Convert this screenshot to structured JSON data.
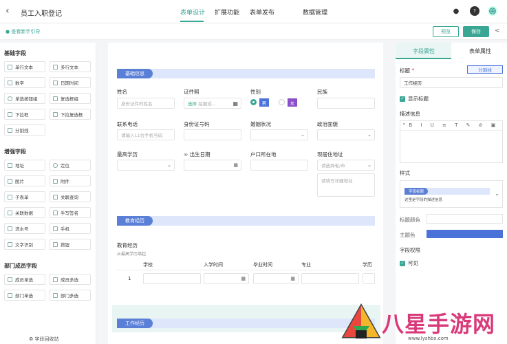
{
  "topbar": {
    "title": "员工入职登记",
    "tabs": [
      "表单设计",
      "扩展功能",
      "表单发布",
      "数据管理"
    ],
    "active_tab": "表单设计",
    "icons": [
      "bell-icon",
      "help-icon",
      "avatar"
    ]
  },
  "subbar": {
    "tip": "查看新手引导",
    "preview_label": "预览",
    "save_label": "保存"
  },
  "left": {
    "basic_group": "基础字段",
    "basic_fields": [
      "单行文本",
      "多行文本",
      "数字",
      "日期时间",
      "单选按钮组",
      "复选框组",
      "下拉框",
      "下拉复选框",
      "分割线"
    ],
    "enhanced_group": "增强字段",
    "enhanced_fields": [
      "地址",
      "定位",
      "图片",
      "附件",
      "子表单",
      "关联查询",
      "关联数据",
      "手写签名",
      "流水号",
      "手机",
      "文字识别",
      "按钮"
    ],
    "dept_group": "部门成员字段",
    "dept_fields": [
      "成员单选",
      "成员多选",
      "部门单选",
      "部门多选"
    ],
    "recycle": "字段回收站"
  },
  "canvas": {
    "section_basic": "基础信息",
    "name_label": "姓名",
    "name_placeholder": "身份证件的姓名",
    "idphoto_label": "证件照",
    "idphoto_select": "选择",
    "idphoto_hint": "拍摄或...",
    "gender_label": "性别",
    "gender_male": "男",
    "gender_female": "女",
    "ethnic_label": "民族",
    "phone_label": "联系电话",
    "phone_placeholder": "请输入11位手机号码",
    "idnum_label": "身份证号码",
    "marital_label": "婚姻状况",
    "political_label": "政治面貌",
    "edu_label": "最高学历",
    "birth_label": "出生日期",
    "hukou_label": "户口所在地",
    "address_label": "现居住地址",
    "address_select_placeholder": "请选择省/市",
    "address_detail_placeholder": "请填写详细地址",
    "section_edu": "教育经历",
    "edu_sub_label": "教育经历",
    "edu_sub_hint": "从最高学历填起",
    "table_headers": [
      "学校",
      "入学时间",
      "毕业时间",
      "专业",
      "学历"
    ],
    "table_row_num": "1",
    "section_work": "工作经历"
  },
  "right": {
    "tab_field": "字段属性",
    "tab_form": "表单属性",
    "title_label": "标题",
    "title_required": "*",
    "divider_btn": "分割线",
    "title_value": "工作经历",
    "show_title": "显示标题",
    "desc_label": "描述信息",
    "style_label": "样式",
    "style_tag": "字段标题",
    "style_desc": "这里是字段的描述信息",
    "title_color_label": "标题颜色",
    "theme_color_label": "主题色",
    "permission_label": "字段权限",
    "visible_label": "可见",
    "theme_color": "#4a72d9"
  },
  "watermark": {
    "brand": "八星手游网",
    "url": "www.lyshbx.com"
  }
}
